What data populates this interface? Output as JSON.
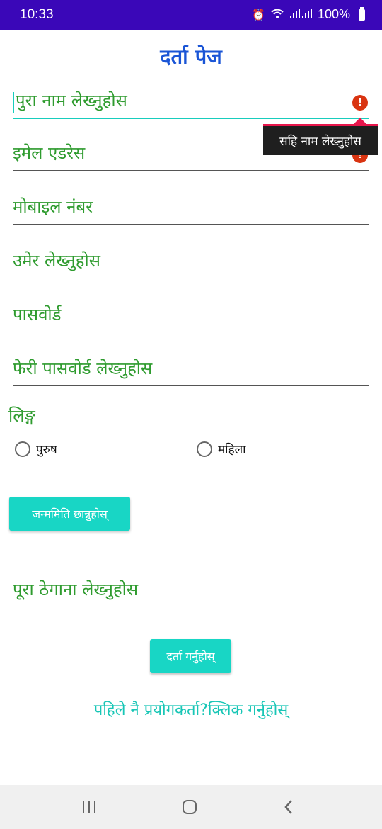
{
  "status_bar": {
    "time": "10:33",
    "battery": "100%"
  },
  "page": {
    "title": "दर्ता पेज"
  },
  "fields": {
    "full_name": {
      "placeholder": "पुरा नाम लेख्नुहोस"
    },
    "email": {
      "placeholder": "इमेल एडरेस"
    },
    "mobile": {
      "placeholder": "मोबाइल नंबर"
    },
    "age": {
      "placeholder": "उमेर लेख्नुहोस"
    },
    "password": {
      "placeholder": "पासवोर्ड"
    },
    "confirm_password": {
      "placeholder": "फेरी पासवोर्ड लेख्नुहोस"
    },
    "address": {
      "placeholder": "पूरा ठेगाना लेख्नुहोस"
    }
  },
  "error_tooltip": "सहि नाम लेख्नुहोस",
  "gender": {
    "label": "लिङ्ग",
    "options": [
      "पुरुष",
      "महिला"
    ]
  },
  "buttons": {
    "dob": "जन्ममिति छान्नुहोस्",
    "submit": "दर्ता गर्नुहोस्"
  },
  "login_link": "पहिले नै प्रयोगकर्ता?क्लिक गर्नुहोस्",
  "colors": {
    "status_bar": "#3a07b8",
    "title": "#1a55d6",
    "placeholder_text": "#2e9b2e",
    "accent": "#18d6c5",
    "error": "#d93411"
  },
  "icons": [
    "alarm-icon",
    "wifi-icon",
    "signal-icon",
    "battery-icon",
    "error-icon",
    "recent-apps-icon",
    "home-icon",
    "back-icon"
  ]
}
